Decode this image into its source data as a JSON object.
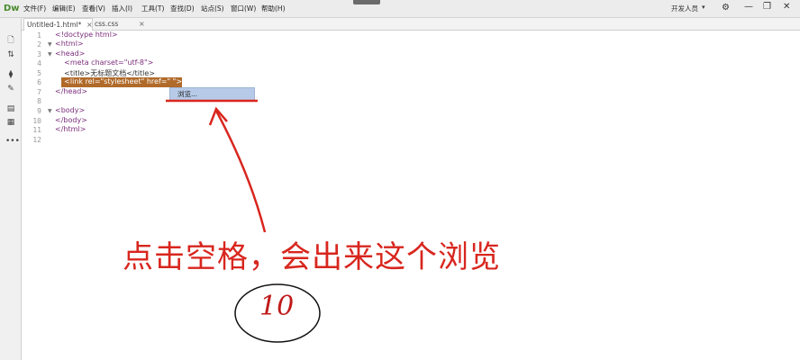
{
  "app": {
    "logo": "Dw"
  },
  "menu": [
    "文件(F)",
    "编辑(E)",
    "查看(V)",
    "插入(I)",
    "工具(T)",
    "查找(D)",
    "站点(S)",
    "窗口(W)",
    "帮助(H)"
  ],
  "workspace": {
    "label": "开发人员",
    "caret": "▾"
  },
  "window": {
    "minimize": "—",
    "restore": "❐",
    "close": "✕"
  },
  "tabs": [
    {
      "label": "Untitled-1.html*",
      "close": "×"
    },
    {
      "label": "css.css",
      "close": "×"
    }
  ],
  "editor": {
    "lines": [
      {
        "n": "1",
        "fold": "",
        "text": "<!doctype html>"
      },
      {
        "n": "2",
        "fold": "▼",
        "text": "<html>"
      },
      {
        "n": "3",
        "fold": "▼",
        "text": "<head>"
      },
      {
        "n": "4",
        "fold": "",
        "text": "    <meta charset=\"utf-8\">"
      },
      {
        "n": "5",
        "fold": "",
        "text": "    <title>无标题文档</title>"
      },
      {
        "n": "6",
        "fold": "",
        "text": "    <link rel=\"stylesheet\" href=\" \">"
      },
      {
        "n": "7",
        "fold": "",
        "text": "</head>"
      },
      {
        "n": "8",
        "fold": "",
        "text": ""
      },
      {
        "n": "9",
        "fold": "▼",
        "text": "<body>"
      },
      {
        "n": "10",
        "fold": "",
        "text": "</body>"
      },
      {
        "n": "11",
        "fold": "",
        "text": "</html>"
      },
      {
        "n": "12",
        "fold": "",
        "text": ""
      }
    ],
    "autocomplete": "浏览..."
  },
  "annotation": {
    "text": "点击空格，会出来这个浏览",
    "step": "10",
    "color": "#d8261e"
  }
}
